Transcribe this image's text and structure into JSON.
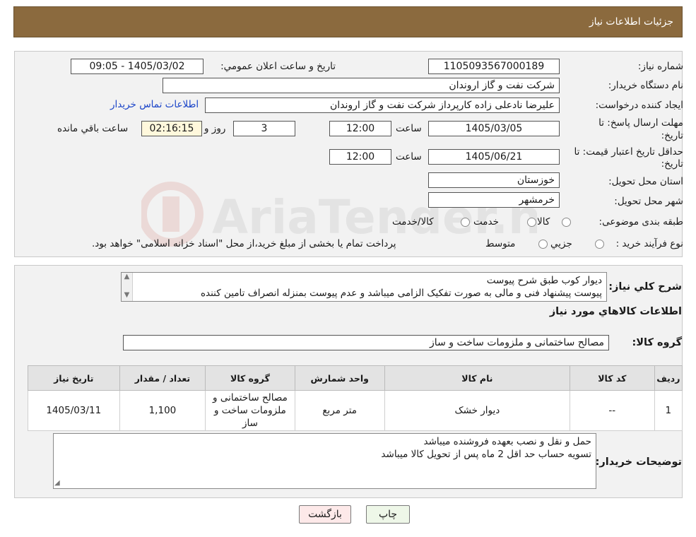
{
  "header": {
    "title": "جزئيات اطلاعات نياز"
  },
  "watermark": {
    "text": "AriaTender.neT"
  },
  "form": {
    "need_number_label": "شماره نياز:",
    "need_number": "1105093567000189",
    "announce_label": "تاريخ و ساعت اعلان عمومي:",
    "announce_value": "1405/03/02 - 09:05",
    "buyer_org_label": "نام دستگاه خريدار:",
    "buyer_org": "شرکت نفت و گاز اروندان",
    "creator_label": "ايجاد کننده درخواست:",
    "creator": "عليرضا نادعلی زاده کارپرداز شرکت نفت و گاز اروندان",
    "contact_link": "اطلاعات تماس خريدار",
    "deadline_label_1": "مهلت ارسال پاسخ: تا",
    "deadline_label_2": "تاريخ:",
    "deadline_date": "1405/03/05",
    "time_label": "ساعت",
    "deadline_time": "12:00",
    "days_value": "3",
    "days_label": "روز و",
    "remaining_value": "02:16:15",
    "remaining_label": "ساعت باقي مانده",
    "validity_label_1": "حداقل تاريخ اعتبار قيمت: تا",
    "validity_label_2": "تاريخ:",
    "validity_date": "1405/06/21",
    "validity_time": "12:00",
    "province_label": "استان محل تحويل:",
    "province": "خوزستان",
    "city_label": "شهر محل تحويل:",
    "city": "خرمشهر",
    "category_label": "طبقه بندی موضوعی:",
    "category_options": [
      "کالا",
      "خدمت",
      "کالا/خدمت"
    ],
    "process_label": "نوع فرآيند خريد :",
    "process_options": [
      "جزيي",
      "متوسط"
    ],
    "process_note": "پرداخت تمام يا بخشی از مبلغ خريد،از محل \"اسناد خزانه اسلامی\" خواهد بود."
  },
  "summary": {
    "description_label": "شرح کلي نياز:",
    "description_lines": [
      "ديوار کوب طبق شرح پيوست",
      "پيوست پيشنهاد فنی و مالی به صورت تفکيک الزامی ميباشد و عدم پيوست بمنزله انصراف تامين کننده"
    ],
    "goods_info_title": "اطلاعات کالاهاي مورد نياز",
    "goods_group_label": "گروه کالا:",
    "goods_group": "مصالح ساختمانی و ملزومات ساخت و ساز"
  },
  "table": {
    "headers": [
      "رديف",
      "کد کالا",
      "نام کالا",
      "واحد شمارش",
      "گروه کالا",
      "تعداد / مقدار",
      "تاريخ نياز"
    ],
    "rows": [
      [
        "1",
        "--",
        "ديوار خشک",
        "متر مربع",
        "مصالح ساختمانی و ملزومات ساخت و ساز",
        "1,100",
        "1405/03/11"
      ]
    ]
  },
  "buyer_notes": {
    "label": "توضيحات خريدار:",
    "lines": [
      "حمل و نقل و نصب بعهده فروشنده ميباشد",
      "تسويه حساب حد اقل 2 ماه پس از تحويل کالا ميباشد"
    ]
  },
  "buttons": {
    "print": "چاپ",
    "back": "بازگشت"
  },
  "colors": {
    "header_bg": "#8b6a3e",
    "link": "#1a44c8",
    "yellow_box": "#fff8dc",
    "back_button": "#fde9e9",
    "print_button": "#eef7e8"
  }
}
